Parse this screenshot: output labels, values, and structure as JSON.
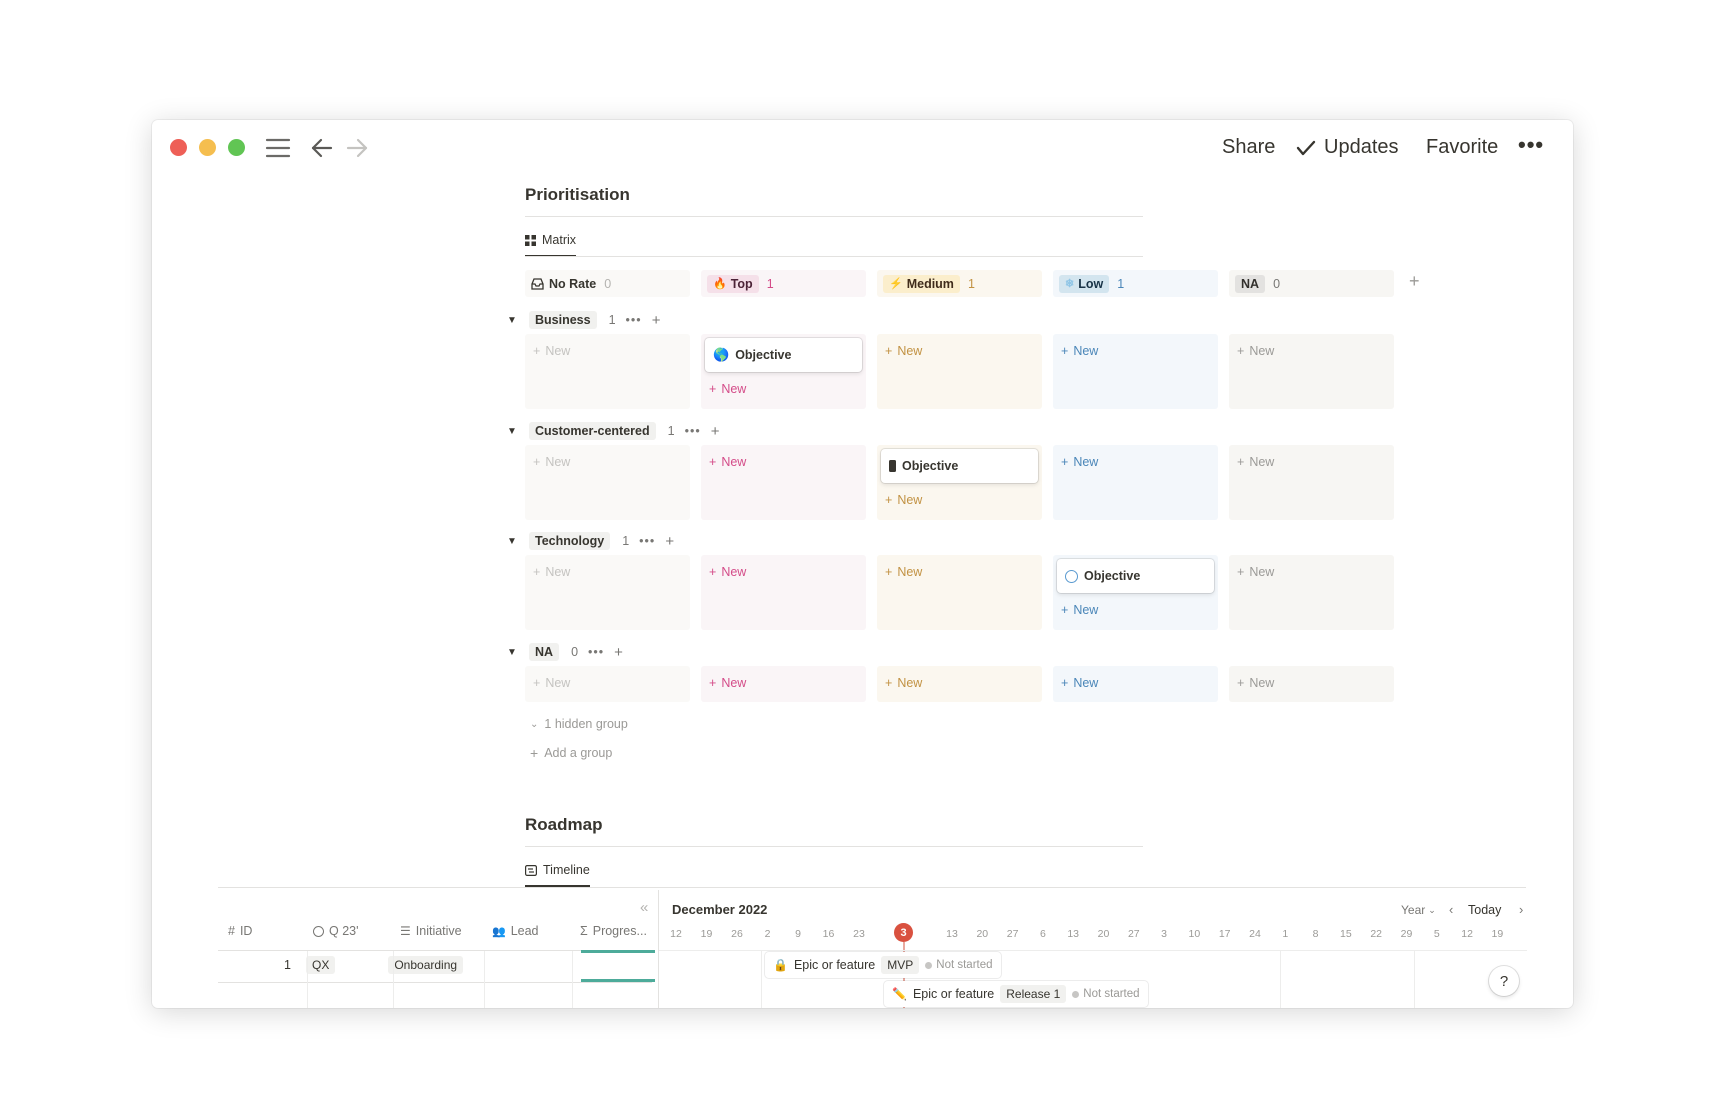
{
  "toolbar": {
    "share": "Share",
    "updates": "Updates",
    "favorite": "Favorite",
    "more": "•••"
  },
  "prioritisation": {
    "title": "Prioritisation",
    "view_tab": "Matrix",
    "columns": [
      {
        "label": "No Rate",
        "count": "0",
        "icon": "inbox-icon"
      },
      {
        "label": "Top",
        "count": "1",
        "icon": "fire-icon"
      },
      {
        "label": "Medium",
        "count": "1",
        "icon": "lightning-icon"
      },
      {
        "label": "Low",
        "count": "1",
        "icon": "snowflake-icon"
      },
      {
        "label": "NA",
        "count": "0",
        "icon": ""
      }
    ],
    "groups": [
      {
        "name": "Business",
        "count": "1"
      },
      {
        "name": "Customer-centered",
        "count": "1"
      },
      {
        "name": "Technology",
        "count": "1"
      },
      {
        "name": "NA",
        "count": "0"
      }
    ],
    "new_label": "New",
    "card_label": "Objective",
    "hidden_group": "1 hidden group",
    "add_group": "Add a group"
  },
  "roadmap": {
    "title": "Roadmap",
    "view_tab": "Timeline",
    "columns": {
      "id": "ID",
      "quarter": "Q 23'",
      "initiative": "Initiative",
      "lead": "Lead",
      "progress": "Progres..."
    },
    "rows": [
      {
        "id": "1",
        "quarter": "QX",
        "initiative": "Onboarding"
      }
    ],
    "month": "December 2022",
    "scale": "Year",
    "today": "Today",
    "today_marker": "3",
    "ticks": [
      "12",
      "19",
      "26",
      "2",
      "9",
      "16",
      "23",
      "13",
      "20",
      "27",
      "6",
      "13",
      "20",
      "27",
      "3",
      "10",
      "17",
      "24",
      "1",
      "8",
      "15",
      "22",
      "29",
      "5",
      "12",
      "19"
    ],
    "bars": [
      {
        "label": "Epic or feature",
        "tag": "MVP",
        "status": "Not started"
      },
      {
        "label": "Epic or feature",
        "tag": "Release 1",
        "status": "Not started"
      }
    ],
    "help": "?"
  },
  "colors": {
    "close": "#ee5f57",
    "minimize": "#f5be4f",
    "maximize": "#61c554",
    "top": "#d44c89",
    "medium": "#c29243",
    "low": "#4a86b8",
    "today": "#d9513f"
  }
}
